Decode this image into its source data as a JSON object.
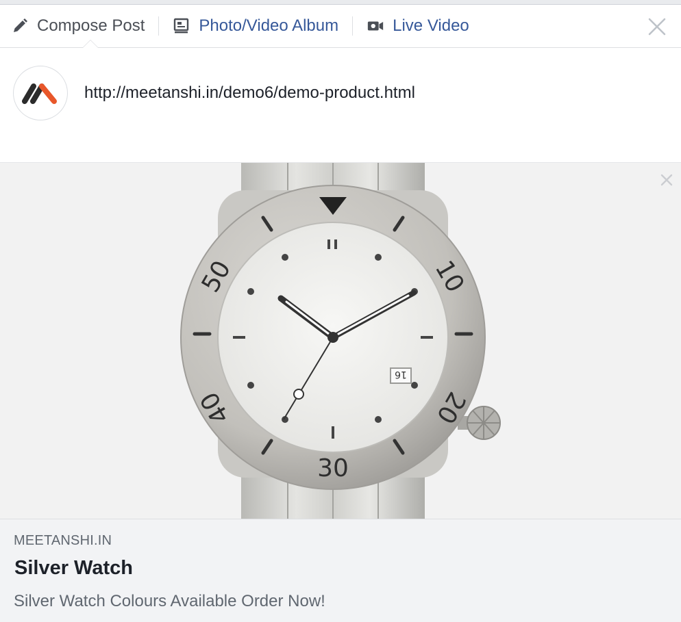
{
  "tabs": {
    "compose": {
      "label": "Compose Post",
      "icon": "pencil-icon"
    },
    "photo_video": {
      "label": "Photo/Video Album",
      "icon": "photo-album-icon"
    },
    "live_video": {
      "label": "Live Video",
      "icon": "video-camera-icon"
    }
  },
  "composer": {
    "text": "http://meetanshi.in/demo6/demo-product.html"
  },
  "preview": {
    "domain": "MEETANSHI.IN",
    "title": "Silver Watch",
    "description": "Silver Watch Colours Available Order Now!",
    "image_icon": "watch-image",
    "bezel_numbers": [
      "10",
      "20",
      "30",
      "40",
      "50"
    ],
    "date_window": "16"
  },
  "colors": {
    "link_blue": "#365899",
    "muted_text": "#606770",
    "brand_orange": "#e8572a",
    "brand_dark": "#2b2b2b"
  }
}
